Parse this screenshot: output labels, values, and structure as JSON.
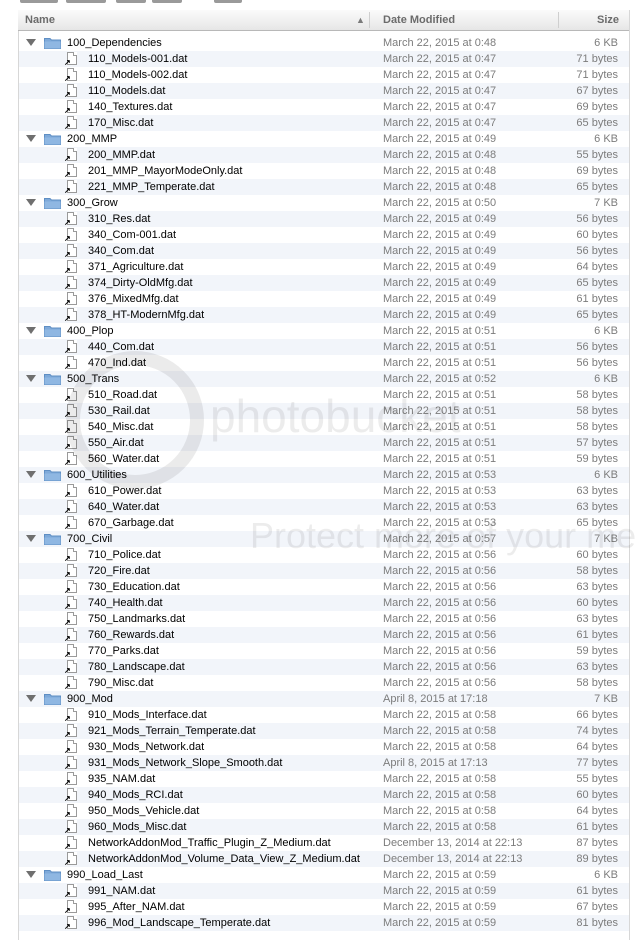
{
  "columns": {
    "name": "Name",
    "date": "Date Modified",
    "size": "Size"
  },
  "colors": {
    "alt_row": "#f2f5fa",
    "secondary_text": "#7c7c7c",
    "folder_blue": "#8fb7e2"
  },
  "icons": {
    "folder": "folder-icon",
    "file": "alias-document-icon",
    "disclosure": "disclosure-triangle-icon",
    "sort": "sort-ascending-icon"
  },
  "rows": [
    {
      "type": "folder",
      "name": "100_Dependencies",
      "date": "March 22, 2015 at 0:48",
      "size": "6 KB"
    },
    {
      "type": "file",
      "name": "110_Models-001.dat",
      "date": "March 22, 2015 at 0:47",
      "size": "71 bytes"
    },
    {
      "type": "file",
      "name": "110_Models-002.dat",
      "date": "March 22, 2015 at 0:47",
      "size": "71 bytes"
    },
    {
      "type": "file",
      "name": "110_Models.dat",
      "date": "March 22, 2015 at 0:47",
      "size": "67 bytes"
    },
    {
      "type": "file",
      "name": "140_Textures.dat",
      "date": "March 22, 2015 at 0:47",
      "size": "69 bytes"
    },
    {
      "type": "file",
      "name": "170_Misc.dat",
      "date": "March 22, 2015 at 0:47",
      "size": "65 bytes"
    },
    {
      "type": "folder",
      "name": "200_MMP",
      "date": "March 22, 2015 at 0:49",
      "size": "6 KB"
    },
    {
      "type": "file",
      "name": "200_MMP.dat",
      "date": "March 22, 2015 at 0:48",
      "size": "55 bytes"
    },
    {
      "type": "file",
      "name": "201_MMP_MayorModeOnly.dat",
      "date": "March 22, 2015 at 0:48",
      "size": "69 bytes"
    },
    {
      "type": "file",
      "name": "221_MMP_Temperate.dat",
      "date": "March 22, 2015 at 0:48",
      "size": "65 bytes"
    },
    {
      "type": "folder",
      "name": "300_Grow",
      "date": "March 22, 2015 at 0:50",
      "size": "7 KB"
    },
    {
      "type": "file",
      "name": "310_Res.dat",
      "date": "March 22, 2015 at 0:49",
      "size": "56 bytes"
    },
    {
      "type": "file",
      "name": "340_Com-001.dat",
      "date": "March 22, 2015 at 0:49",
      "size": "60 bytes"
    },
    {
      "type": "file",
      "name": "340_Com.dat",
      "date": "March 22, 2015 at 0:49",
      "size": "56 bytes"
    },
    {
      "type": "file",
      "name": "371_Agriculture.dat",
      "date": "March 22, 2015 at 0:49",
      "size": "64 bytes"
    },
    {
      "type": "file",
      "name": "374_Dirty-OldMfg.dat",
      "date": "March 22, 2015 at 0:49",
      "size": "65 bytes"
    },
    {
      "type": "file",
      "name": "376_MixedMfg.dat",
      "date": "March 22, 2015 at 0:49",
      "size": "61 bytes"
    },
    {
      "type": "file",
      "name": "378_HT-ModernMfg.dat",
      "date": "March 22, 2015 at 0:49",
      "size": "65 bytes"
    },
    {
      "type": "folder",
      "name": "400_Plop",
      "date": "March 22, 2015 at 0:51",
      "size": "6 KB"
    },
    {
      "type": "file",
      "name": "440_Com.dat",
      "date": "March 22, 2015 at 0:51",
      "size": "56 bytes"
    },
    {
      "type": "file",
      "name": "470_Ind.dat",
      "date": "March 22, 2015 at 0:51",
      "size": "56 bytes"
    },
    {
      "type": "folder",
      "name": "500_Trans",
      "date": "March 22, 2015 at 0:52",
      "size": "6 KB"
    },
    {
      "type": "file",
      "name": "510_Road.dat",
      "date": "March 22, 2015 at 0:51",
      "size": "58 bytes"
    },
    {
      "type": "file",
      "name": "530_Rail.dat",
      "date": "March 22, 2015 at 0:51",
      "size": "58 bytes"
    },
    {
      "type": "file",
      "name": "540_Misc.dat",
      "date": "March 22, 2015 at 0:51",
      "size": "58 bytes"
    },
    {
      "type": "file",
      "name": "550_Air.dat",
      "date": "March 22, 2015 at 0:51",
      "size": "57 bytes"
    },
    {
      "type": "file",
      "name": "560_Water.dat",
      "date": "March 22, 2015 at 0:51",
      "size": "59 bytes"
    },
    {
      "type": "folder",
      "name": "600_Utilities",
      "date": "March 22, 2015 at 0:53",
      "size": "6 KB"
    },
    {
      "type": "file",
      "name": "610_Power.dat",
      "date": "March 22, 2015 at 0:53",
      "size": "63 bytes"
    },
    {
      "type": "file",
      "name": "640_Water.dat",
      "date": "March 22, 2015 at 0:53",
      "size": "63 bytes"
    },
    {
      "type": "file",
      "name": "670_Garbage.dat",
      "date": "March 22, 2015 at 0:53",
      "size": "65 bytes"
    },
    {
      "type": "folder",
      "name": "700_Civil",
      "date": "March 22, 2015 at 0:57",
      "size": "7 KB"
    },
    {
      "type": "file",
      "name": "710_Police.dat",
      "date": "March 22, 2015 at 0:56",
      "size": "60 bytes"
    },
    {
      "type": "file",
      "name": "720_Fire.dat",
      "date": "March 22, 2015 at 0:56",
      "size": "58 bytes"
    },
    {
      "type": "file",
      "name": "730_Education.dat",
      "date": "March 22, 2015 at 0:56",
      "size": "63 bytes"
    },
    {
      "type": "file",
      "name": "740_Health.dat",
      "date": "March 22, 2015 at 0:56",
      "size": "60 bytes"
    },
    {
      "type": "file",
      "name": "750_Landmarks.dat",
      "date": "March 22, 2015 at 0:56",
      "size": "63 bytes"
    },
    {
      "type": "file",
      "name": "760_Rewards.dat",
      "date": "March 22, 2015 at 0:56",
      "size": "61 bytes"
    },
    {
      "type": "file",
      "name": "770_Parks.dat",
      "date": "March 22, 2015 at 0:56",
      "size": "59 bytes"
    },
    {
      "type": "file",
      "name": "780_Landscape.dat",
      "date": "March 22, 2015 at 0:56",
      "size": "63 bytes"
    },
    {
      "type": "file",
      "name": "790_Misc.dat",
      "date": "March 22, 2015 at 0:56",
      "size": "58 bytes"
    },
    {
      "type": "folder",
      "name": "900_Mod",
      "date": "April 8, 2015 at 17:18",
      "size": "7 KB"
    },
    {
      "type": "file",
      "name": "910_Mods_Interface.dat",
      "date": "March 22, 2015 at 0:58",
      "size": "66 bytes"
    },
    {
      "type": "file",
      "name": "921_Mods_Terrain_Temperate.dat",
      "date": "March 22, 2015 at 0:58",
      "size": "74 bytes"
    },
    {
      "type": "file",
      "name": "930_Mods_Network.dat",
      "date": "March 22, 2015 at 0:58",
      "size": "64 bytes"
    },
    {
      "type": "file",
      "name": "931_Mods_Network_Slope_Smooth.dat",
      "date": "April 8, 2015 at 17:13",
      "size": "77 bytes"
    },
    {
      "type": "file",
      "name": "935_NAM.dat",
      "date": "March 22, 2015 at 0:58",
      "size": "55 bytes"
    },
    {
      "type": "file",
      "name": "940_Mods_RCI.dat",
      "date": "March 22, 2015 at 0:58",
      "size": "60 bytes"
    },
    {
      "type": "file",
      "name": "950_Mods_Vehicle.dat",
      "date": "March 22, 2015 at 0:58",
      "size": "64 bytes"
    },
    {
      "type": "file",
      "name": "960_Mods_Misc.dat",
      "date": "March 22, 2015 at 0:58",
      "size": "61 bytes"
    },
    {
      "type": "file",
      "name": "NetworkAddonMod_Traffic_Plugin_Z_Medium.dat",
      "date": "December 13, 2014 at 22:13",
      "size": "87 bytes"
    },
    {
      "type": "file",
      "name": "NetworkAddonMod_Volume_Data_View_Z_Medium.dat",
      "date": "December 13, 2014 at 22:13",
      "size": "89 bytes"
    },
    {
      "type": "folder",
      "name": "990_Load_Last",
      "date": "March 22, 2015 at 0:59",
      "size": "6 KB"
    },
    {
      "type": "file",
      "name": "991_NAM.dat",
      "date": "March 22, 2015 at 0:59",
      "size": "61 bytes"
    },
    {
      "type": "file",
      "name": "995_After_NAM.dat",
      "date": "March 22, 2015 at 0:59",
      "size": "67 bytes"
    },
    {
      "type": "file",
      "name": "996_Mod_Landscape_Temperate.dat",
      "date": "March 22, 2015 at 0:59",
      "size": "81 bytes"
    }
  ]
}
